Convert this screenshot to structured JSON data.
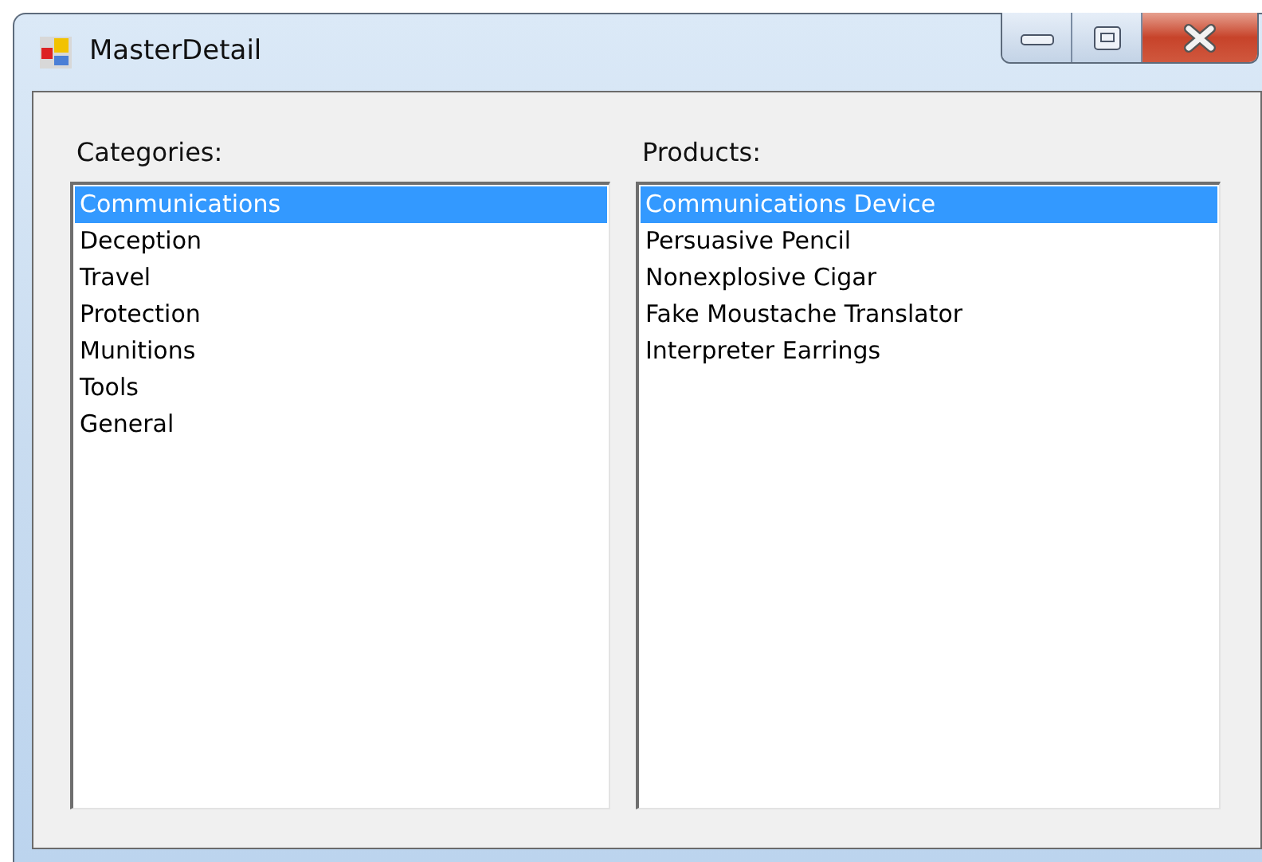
{
  "window": {
    "title": "MasterDetail"
  },
  "lists": [
    {
      "label": "Categories:",
      "items": [
        {
          "text": "Communications",
          "selected": true
        },
        {
          "text": "Deception",
          "selected": false
        },
        {
          "text": "Travel",
          "selected": false
        },
        {
          "text": "Protection",
          "selected": false
        },
        {
          "text": "Munitions",
          "selected": false
        },
        {
          "text": "Tools",
          "selected": false
        },
        {
          "text": "General",
          "selected": false
        }
      ]
    },
    {
      "label": "Products:",
      "items": [
        {
          "text": "Communications Device",
          "selected": true
        },
        {
          "text": "Persuasive Pencil",
          "selected": false
        },
        {
          "text": "Nonexplosive Cigar",
          "selected": false
        },
        {
          "text": "Fake Moustache Translator",
          "selected": false
        },
        {
          "text": "Interpreter Earrings",
          "selected": false
        }
      ]
    }
  ]
}
